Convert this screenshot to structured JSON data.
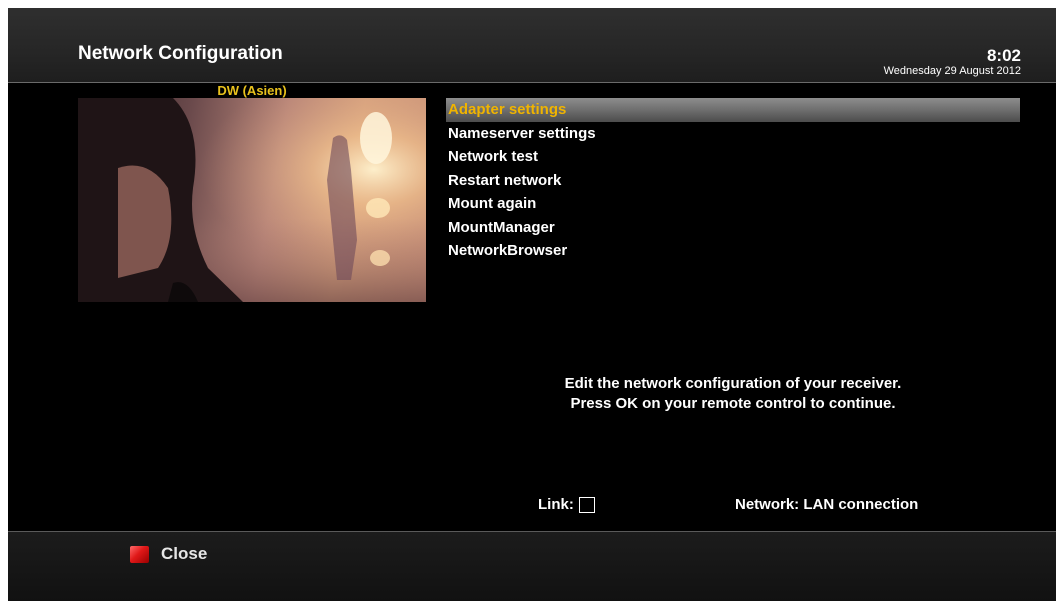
{
  "header": {
    "title": "Network Configuration",
    "time": "8:02",
    "date": "Wednesday 29 August 2012"
  },
  "preview": {
    "channel": "DW (Asien)"
  },
  "menu": {
    "items": [
      {
        "label": "Adapter settings",
        "selected": true
      },
      {
        "label": "Nameserver settings",
        "selected": false
      },
      {
        "label": "Network test",
        "selected": false
      },
      {
        "label": "Restart network",
        "selected": false
      },
      {
        "label": "Mount again",
        "selected": false
      },
      {
        "label": "MountManager",
        "selected": false
      },
      {
        "label": "NetworkBrowser",
        "selected": false
      }
    ]
  },
  "description": {
    "line1": "Edit the network configuration of your receiver.",
    "line2": "Press OK on your remote control to continue."
  },
  "status": {
    "link_label": "Link:",
    "link_checked": false,
    "network_label": "Network: LAN connection"
  },
  "footer": {
    "close_label": "Close",
    "close_key_color": "#e01818"
  },
  "colors": {
    "selected_text": "#f0b400",
    "channel_text": "#e8c11c",
    "background": "#000000"
  },
  "icons": {
    "red_key": "red-key-icon",
    "link_checkbox": "checkbox-icon"
  }
}
